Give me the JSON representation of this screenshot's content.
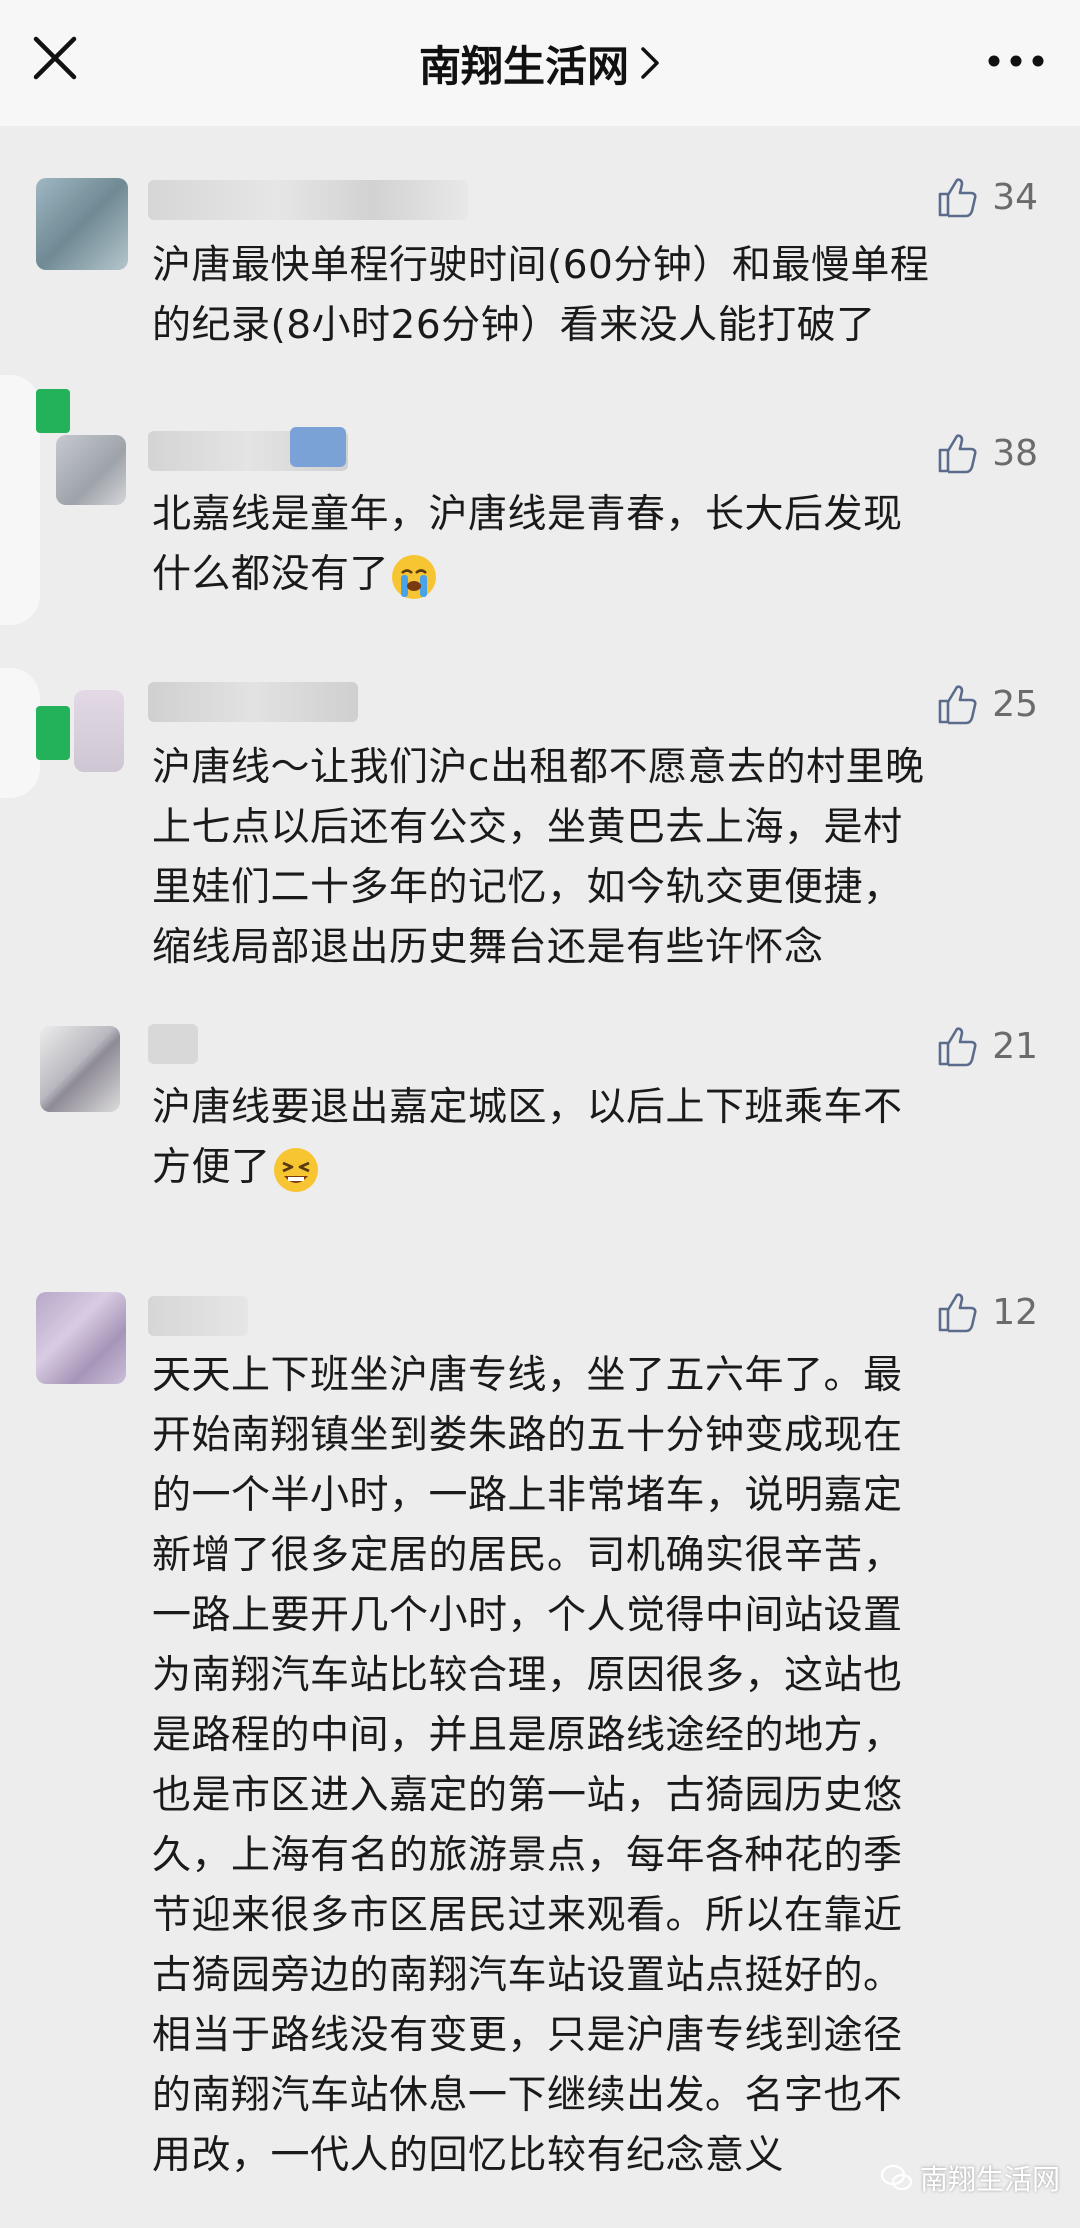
{
  "header": {
    "title": "南翔生活网",
    "close_icon": "close-icon",
    "more_icon": "more-dots-icon"
  },
  "comments": [
    {
      "likes": "34",
      "text": "沪唐最快单程行驶时间(60分钟）和最慢单程\n的纪录(8小时26分钟）看来没人能打破了"
    },
    {
      "likes": "38",
      "text_before": "北嘉线是童年，沪唐线是青春，长大后发现\n什么都没有了",
      "emoji": "crying-face"
    },
    {
      "likes": "25",
      "text": "沪唐线～让我们沪c出租都不愿意去的村里晚\n上七点以后还有公交，坐黄巴去上海，是村\n里娃们二十多年的记忆，如今轨交更便捷，\n缩线局部退出历史舞台还是有些许怀念"
    },
    {
      "likes": "21",
      "text_before": "沪唐线要退出嘉定城区，以后上下班乘车不\n方便了",
      "emoji": "tired-face"
    },
    {
      "likes": "12",
      "text": "天天上下班坐沪唐专线，坐了五六年了。最\n开始南翔镇坐到娄朱路的五十分钟变成现在\n的一个半小时，一路上非常堵车，说明嘉定\n新增了很多定居的居民。司机确实很辛苦，\n一路上要开几个小时，个人觉得中间站设置\n为南翔汽车站比较合理，原因很多，这站也\n是路程的中间，并且是原路线途经的地方，\n也是市区进入嘉定的第一站，古猗园历史悠\n久，上海有名的旅游景点，每年各种花的季\n节迎来很多市区居民过来观看。所以在靠近\n古猗园旁边的南翔汽车站设置站点挺好的。\n相当于路线没有变更，只是沪唐专线到途径\n的南翔汽车站休息一下继续出发。名字也不\n用改，一代人的回忆比较有纪念意义"
    }
  ],
  "watermark": "南翔生活网",
  "colors": {
    "background": "#ededed",
    "header": "#f7f7f7",
    "like": "#5b6b8c",
    "badge": "#23b15a"
  }
}
